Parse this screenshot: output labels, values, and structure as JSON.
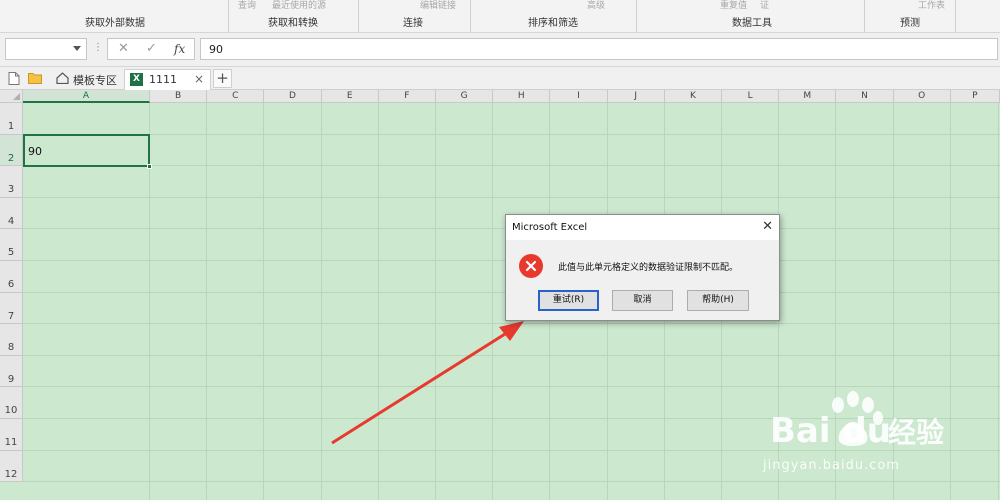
{
  "ribbon": {
    "faded": [
      "查询",
      "最近使用的源",
      "编辑链接",
      "高级",
      "重复值",
      "证",
      "工作表"
    ],
    "groups": [
      "获取外部数据",
      "获取和转换",
      "连接",
      "排序和筛选",
      "数据工具",
      "预测"
    ]
  },
  "formula_bar": {
    "name_box": "",
    "cancel_icon": "✕",
    "enter_icon": "✓",
    "fx_label": "fx",
    "value": "90"
  },
  "tabs": {
    "home_tab": "模板专区",
    "file_tab": "1111",
    "excel_badge": "X",
    "close_glyph": "×",
    "add_glyph": "+"
  },
  "sheet": {
    "columns": [
      "A",
      "B",
      "C",
      "D",
      "E",
      "F",
      "G",
      "H",
      "I",
      "J",
      "K",
      "L",
      "M",
      "N",
      "O",
      "P"
    ],
    "rows": [
      "1",
      "2",
      "3",
      "4",
      "5",
      "6",
      "7",
      "8",
      "9",
      "10",
      "11",
      "12"
    ],
    "selected_column": "A",
    "selected_row": "2",
    "cell_A2": "90",
    "background_color": "#cce8cf"
  },
  "dialog": {
    "title": "Microsoft Excel",
    "close_glyph": "✕",
    "message": "此值与此单元格定义的数据验证限制不匹配。",
    "buttons": {
      "retry": "重试(R)",
      "cancel": "取消",
      "help": "帮助(H)"
    },
    "icon": "error-icon"
  },
  "watermark": {
    "logo": "Bai du 经验",
    "url": "jingyan.baidu.com"
  },
  "colors": {
    "accent": "#217346",
    "arrow": "#e8392f",
    "error": "#e8392f",
    "default_button_border": "#2a62c9"
  }
}
